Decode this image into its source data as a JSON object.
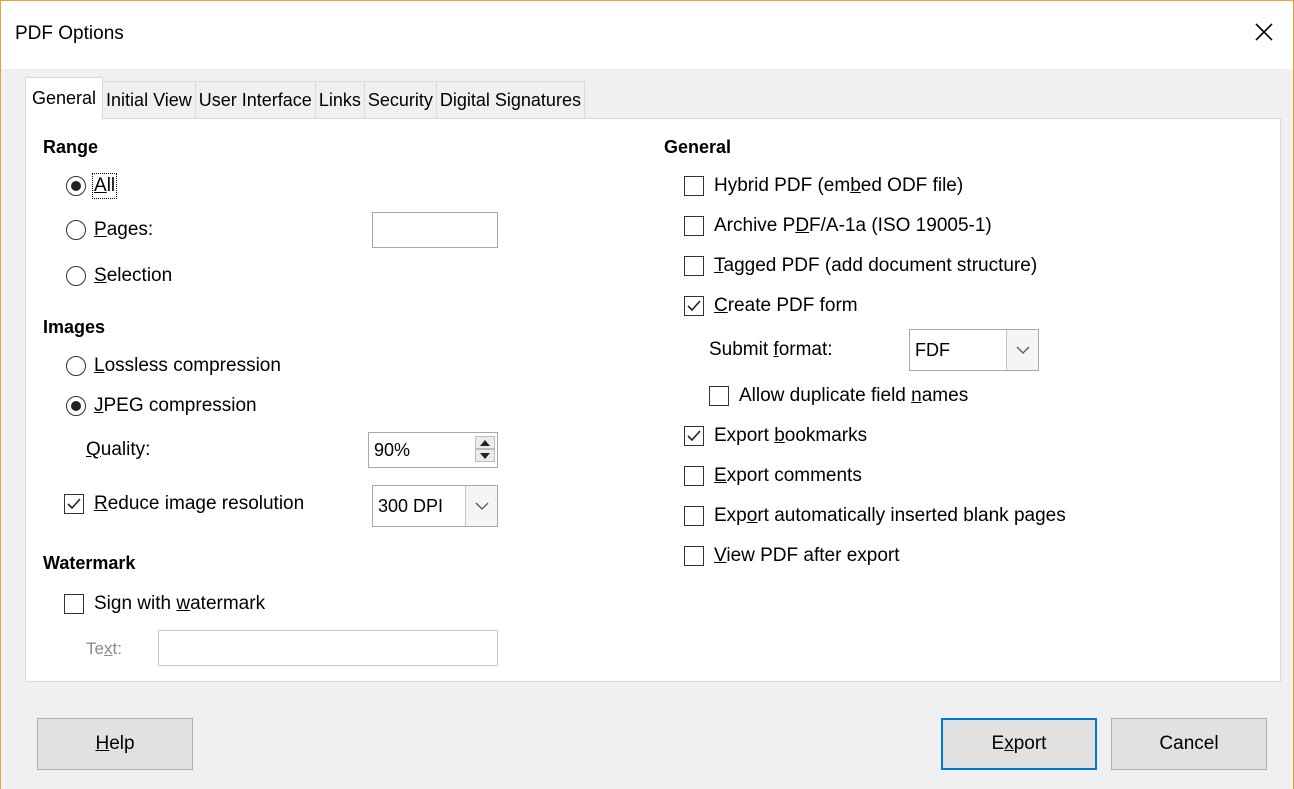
{
  "window": {
    "title": "PDF Options"
  },
  "tabs": [
    {
      "label": "General",
      "active": true
    },
    {
      "label": "Initial View",
      "active": false
    },
    {
      "label": "User Interface",
      "active": false
    },
    {
      "label": "Links",
      "active": false
    },
    {
      "label": "Security",
      "active": false
    },
    {
      "label": "Digital Signatures",
      "active": false
    }
  ],
  "range": {
    "heading": "Range",
    "all": {
      "key": "A",
      "rest": "ll",
      "selected": true
    },
    "pages": {
      "key": "P",
      "rest": "ages:",
      "selected": false,
      "value": ""
    },
    "selection": {
      "key": "S",
      "rest": "election",
      "selected": false
    }
  },
  "images": {
    "heading": "Images",
    "lossless": {
      "key": "L",
      "rest": "ossless compression",
      "selected": false
    },
    "jpeg": {
      "key": "J",
      "rest": "PEG compression",
      "selected": true
    },
    "quality": {
      "key": "Q",
      "rest": "uality:",
      "value": "90%"
    },
    "reduce": {
      "key": "R",
      "rest": "educe image resolution",
      "checked": true,
      "value": "300 DPI"
    }
  },
  "watermark": {
    "heading": "Watermark",
    "sign": {
      "pre": "Sign with ",
      "key": "w",
      "rest": "atermark",
      "checked": false
    },
    "text": {
      "pre": "Te",
      "key": "x",
      "rest": "t:",
      "value": ""
    }
  },
  "general": {
    "heading": "General",
    "hybrid": {
      "pre": "Hybrid PDF (em",
      "key": "b",
      "rest": "ed ODF file)",
      "checked": false
    },
    "archive": {
      "pre": "Archive P",
      "key": "D",
      "rest": "F/A-1a (ISO 19005-1)",
      "checked": false
    },
    "tagged": {
      "pre": "",
      "key": "T",
      "rest": "agged PDF (add document structure)",
      "checked": false
    },
    "form": {
      "pre": "",
      "key": "C",
      "rest": "reate PDF form",
      "checked": true
    },
    "submit": {
      "pre": "Submit ",
      "key": "f",
      "rest": "ormat:",
      "value": "FDF"
    },
    "duplicate": {
      "pre": "Allow duplicate field ",
      "key": "n",
      "rest": "ames",
      "checked": false
    },
    "bookmarks": {
      "pre": "Export ",
      "key": "b",
      "rest": "ookmarks",
      "checked": true
    },
    "comments": {
      "pre": "",
      "key": "E",
      "rest": "xport comments",
      "checked": false
    },
    "blank": {
      "pre": "Exp",
      "key": "o",
      "rest": "rt automatically inserted blank pages",
      "checked": false
    },
    "view": {
      "pre": "",
      "key": "V",
      "rest": "iew PDF after export",
      "checked": false
    }
  },
  "buttons": {
    "help": {
      "key": "H",
      "rest": "elp"
    },
    "export": {
      "pre": "E",
      "key": "x",
      "rest": "port"
    },
    "cancel": {
      "label": "Cancel"
    }
  }
}
